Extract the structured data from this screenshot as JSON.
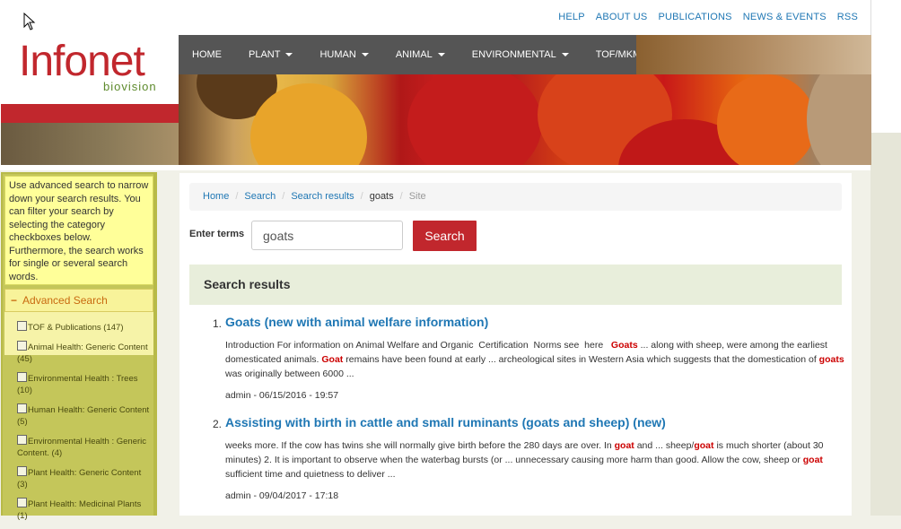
{
  "top_links": [
    "HELP",
    "ABOUT US",
    "PUBLICATIONS",
    "NEWS & EVENTS",
    "RSS"
  ],
  "logo": {
    "main": "Infonet",
    "sub": "biovision"
  },
  "nav": [
    {
      "label": "HOME",
      "caret": false
    },
    {
      "label": "PLANT",
      "caret": true
    },
    {
      "label": "HUMAN",
      "caret": true
    },
    {
      "label": "ANIMAL",
      "caret": true
    },
    {
      "label": "ENVIRONMENTAL",
      "caret": true
    },
    {
      "label": "TOF/MKM",
      "caret": false
    }
  ],
  "sidebar": {
    "help_text": "Use advanced search to narrow down your search results. You can filter your search by selecting the category checkboxes below. Furthermore, the search works for single or several search words.",
    "advanced_title": "Advanced Search",
    "filters": [
      "TOF & Publications (147)",
      "Animal Health: Generic Content (45)",
      "Environmental Health : Trees (10)",
      "Human Health: Generic Content (5)",
      "Environmental Health : Generic Content. (4)",
      "Plant Health: Generic Content (3)",
      "Plant Health: Medicinal Plants (1)"
    ]
  },
  "breadcrumb": {
    "home": "Home",
    "search": "Search",
    "results": "Search results",
    "current": "goats",
    "site": "Site"
  },
  "search": {
    "label": "Enter terms",
    "value": "goats",
    "button": "Search"
  },
  "results_heading": "Search results",
  "results": [
    {
      "num": "1.",
      "title": "Goats (new with animal welfare information)",
      "snippet_html": "Introduction For information on Animal Welfare and Organic&nbsp; Certification&nbsp; Norms see&nbsp; here&nbsp; <span class=\"hl\">&nbsp;Goats</span> ... along with sheep, were among the earliest domesticated animals. <span class=\"hl\">Goat</span> remains have been found at early ... archeological sites in Western Asia which suggests that the domestication of <span class=\"hl\">goats</span> was originally between 6000 ...",
      "meta": "admin - 06/15/2016 - 19:57"
    },
    {
      "num": "2.",
      "title": "Assisting with birth in cattle and small ruminants (goats and sheep) (new)",
      "snippet_html": "weeks more. If the cow has twins she will normally give birth before the 280 days are over. In <span class=\"hl\">goat</span> and ... sheep/<span class=\"hl\">goat</span> is much shorter (about 30 minutes) 2. It is important to observe when the waterbag bursts (or ... unnecessary causing more harm than good. Allow the cow, sheep or <span class=\"hl\">goat</span> sufficient time and quietness to deliver ...",
      "meta": "admin - 09/04/2017 - 17:18"
    }
  ],
  "colors": {
    "brand_red": "#c1272d",
    "link_blue": "#1f77b4",
    "nav_gray": "#555555",
    "sidebar_olive": "#c4c65a"
  }
}
